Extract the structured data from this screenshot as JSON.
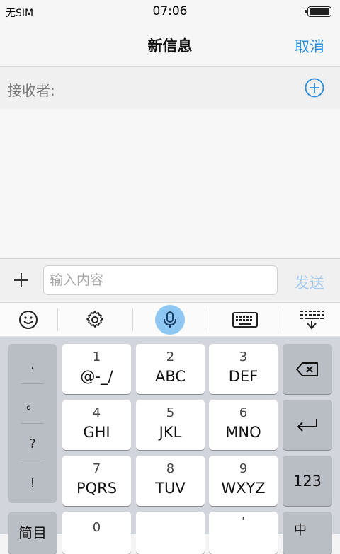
{
  "status": {
    "carrier": "无SIM",
    "time": "07:06",
    "battery_level": 1.0
  },
  "navbar": {
    "title": "新信息",
    "cancel": "取消"
  },
  "recipient": {
    "label": "接收者:",
    "add_icon": "plus-circle-icon"
  },
  "composer": {
    "placeholder": "输入内容",
    "send": "发送",
    "plus_icon": "plus-icon"
  },
  "toolbar": {
    "items": [
      {
        "icon": "emoji-icon"
      },
      {
        "icon": "gear-icon"
      },
      {
        "icon": "microphone-icon",
        "active": true
      },
      {
        "icon": "keyboard-icon"
      },
      {
        "icon": "hide-keyboard-icon"
      }
    ],
    "mic_color": "#8ec7f2"
  },
  "keyboard": {
    "punctuation": [
      ",",
      "。",
      "?",
      "!"
    ],
    "keys": [
      {
        "num": "1",
        "letters": "@-_/"
      },
      {
        "num": "2",
        "letters": "ABC"
      },
      {
        "num": "3",
        "letters": "DEF"
      },
      {
        "num": "4",
        "letters": "GHI"
      },
      {
        "num": "5",
        "letters": "JKL"
      },
      {
        "num": "6",
        "letters": "MNO"
      },
      {
        "num": "7",
        "letters": "PQRS"
      },
      {
        "num": "8",
        "letters": "TUV"
      },
      {
        "num": "9",
        "letters": "WXYZ"
      }
    ],
    "backspace_icon": "backspace-icon",
    "enter_icon": "return-icon",
    "numeric_toggle": "123",
    "bottom_left": "简目",
    "bottom_zero": "0",
    "bottom_comma": "'",
    "bottom_right": "中"
  },
  "colors": {
    "accent": "#2a8ee0",
    "send_disabled": "#a6cbee"
  }
}
